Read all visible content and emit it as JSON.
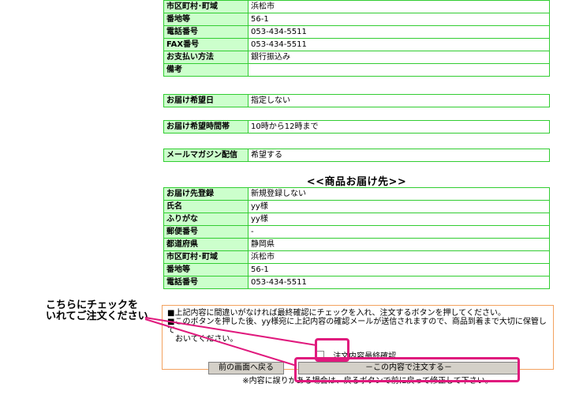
{
  "table1": [
    {
      "label": "市区町村･町域",
      "value": "浜松市"
    },
    {
      "label": "番地等",
      "value": "56-1"
    },
    {
      "label": "電話番号",
      "value": "053-434-5511"
    },
    {
      "label": "FAX番号",
      "value": "053-434-5511"
    },
    {
      "label": "お支払い方法",
      "value": "銀行振込み"
    },
    {
      "label": "備考",
      "value": ""
    }
  ],
  "delivery_date": {
    "label": "お届け希望日",
    "value": "指定しない"
  },
  "delivery_time": {
    "label": "お届け希望時間帯",
    "value": "10時から12時まで"
  },
  "newsletter": {
    "label": "メールマガジン配信",
    "value": "希望する"
  },
  "shipping_section_title": "<<商品お届け先>>",
  "table2": [
    {
      "label": "お届け先登録",
      "value": "新規登録しない"
    },
    {
      "label": "氏名",
      "value": "yy様"
    },
    {
      "label": "ふりがな",
      "value": "yy様"
    },
    {
      "label": "郵便番号",
      "value": "-"
    },
    {
      "label": "都道府県",
      "value": "静岡県"
    },
    {
      "label": "市区町村･町域",
      "value": "浜松市"
    },
    {
      "label": "番地等",
      "value": "56-1"
    },
    {
      "label": "電話番号",
      "value": "053-434-5511"
    }
  ],
  "callout": {
    "line1": "こちらにチェックを",
    "line2": "いれてご注文ください"
  },
  "notice": {
    "line1": "■上記内容に間違いがなければ最終確認にチェックを入れ、注文するボタンを押してください。",
    "line2": "■このボタンを押した後、yy様宛に上記内容の確認メールが送信されますので、商品到着まで大切に保管して",
    "line3": "　おいてください。"
  },
  "checkbox_label": "注文内容最終確認",
  "buttons": {
    "back": "前の画面へ戻る",
    "order": "－この内容で注文する－"
  },
  "error_note": "※内容に誤りがある場合は、戻るボタンで前に戻って修正して下さい。",
  "colors": {
    "table_border": "#32cd32",
    "label_bg": "#ccffcc",
    "highlight": "#e0197d",
    "confirm_border": "#f3a25f"
  }
}
